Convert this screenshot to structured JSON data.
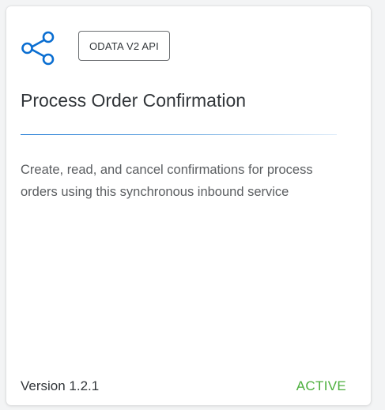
{
  "card": {
    "icon": "share-icon",
    "badge": "ODATA V2 API",
    "title": "Process Order Confirmation",
    "description": "Create, read, and cancel confirmations for process orders using this synchronous inbound service",
    "version": "Version 1.2.1",
    "status": "ACTIVE"
  },
  "colors": {
    "accent": "#0a6ed1",
    "status_active": "#4caf3d",
    "title_text": "#32363a",
    "body_text": "#5b5e61"
  }
}
